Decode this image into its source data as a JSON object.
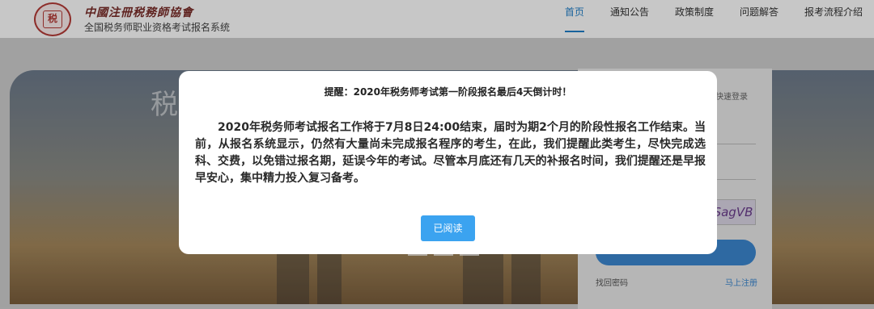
{
  "header": {
    "logo_mark": "税",
    "brand_calligraphy": "中國注冊税務師協會",
    "system_name": "全国税务师职业资格考试报名系统",
    "nav": [
      {
        "label": "首页",
        "active": true
      },
      {
        "label": "通知公告",
        "active": false
      },
      {
        "label": "政策制度",
        "active": false
      },
      {
        "label": "问题解答",
        "active": false
      },
      {
        "label": "报考流程介绍",
        "active": false
      }
    ]
  },
  "background": {
    "banner_text": "税",
    "qr_login_hint": "机快速登录",
    "captcha_text": "SagVB",
    "forgot_password": "找回密码",
    "register": "马上注册"
  },
  "modal": {
    "title": "提醒：2020年税务师考试第一阶段报名最后4天倒计时！",
    "body": "2020年税务师考试报名工作将于7月8日24:00结束，届时为期2个月的阶段性报名工作结束。当前，从报名系统显示，仍然有大量尚未完成报名程序的考生，在此，我们提醒此类考生，尽快完成选科、交费，以免错过报名期，延误今年的考试。尽管本月底还有几天的补报名时间，我们提醒还是早报早安心，集中精力投入复习备考。",
    "confirm_button": "已阅读"
  },
  "colors": {
    "accent": "#1e7ec8",
    "button": "#3ba3f0",
    "brand_red": "#b53a36"
  }
}
